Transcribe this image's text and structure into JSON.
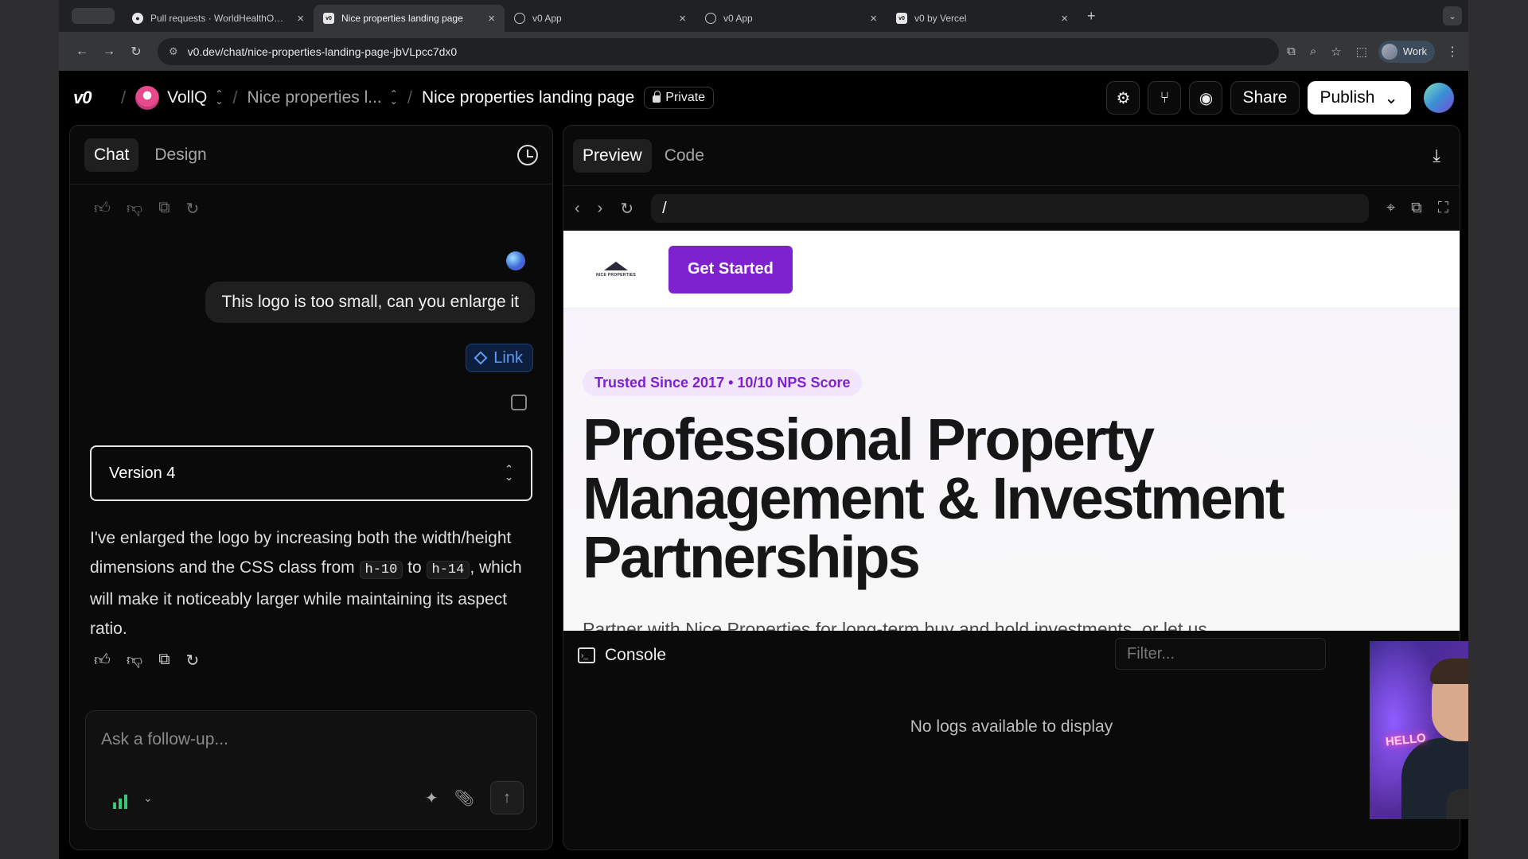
{
  "browser": {
    "tabs": [
      {
        "title": "Pull requests · WorldHealthO…",
        "favicon": "github-icon",
        "active": false
      },
      {
        "title": "Nice properties landing page",
        "favicon": "v0-icon",
        "active": true
      },
      {
        "title": "v0 App",
        "favicon": "globe-icon",
        "active": false
      },
      {
        "title": "v0 App",
        "favicon": "globe-icon",
        "active": false
      },
      {
        "title": "v0 by Vercel",
        "favicon": "v0-icon",
        "active": false
      }
    ],
    "url": "v0.dev/chat/nice-properties-landing-page-jbVLpcc7dx0",
    "profile_label": "Work"
  },
  "header": {
    "logo": "v0",
    "team": "VollQ",
    "project": "Nice properties l...",
    "chat_title": "Nice properties landing page",
    "visibility": "Private",
    "share_label": "Share",
    "publish_label": "Publish"
  },
  "chat": {
    "tabs": [
      "Chat",
      "Design"
    ],
    "user_message": "This logo is too small, can you enlarge it",
    "link_label": "Link",
    "version_label": "Version 4",
    "assistant": {
      "p1": "I've enlarged the logo by increasing both the width/height dimensions and the CSS class from",
      "code1": "h-10",
      "p2": "to",
      "code2": "h-14",
      "p3": ", which will make it noticeably larger while maintaining its aspect ratio."
    },
    "input_placeholder": "Ask a follow-up..."
  },
  "preview": {
    "tabs": [
      "Preview",
      "Code"
    ],
    "path": "/",
    "site": {
      "logo_text": "NICE PROPERTIES",
      "cta": "Get Started",
      "badge": "Trusted Since 2017 • 10/10 NPS Score",
      "title": "Professional Property Management & Investment Partnerships",
      "subtitle": "Partner with Nice Properties for long-term buy and hold investments, or let us",
      "accent": "#7e22ce"
    },
    "console": {
      "label": "Console",
      "filter_placeholder": "Filter...",
      "empty": "No logs available to display"
    }
  },
  "webcam": {
    "neon_sign": "HELLO"
  }
}
